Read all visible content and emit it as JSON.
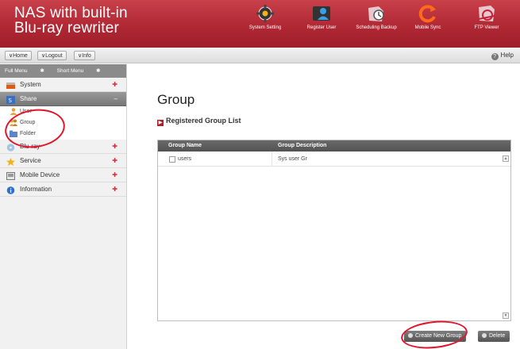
{
  "header": {
    "title_line1": "NAS with built-in",
    "title_line2": "Blu-ray rewriter",
    "nav": [
      {
        "label": "System Setting",
        "icon": "gear-icon"
      },
      {
        "label": "Register User",
        "icon": "register-user-icon"
      },
      {
        "label": "Scheduling Backup",
        "icon": "scheduling-backup-icon"
      },
      {
        "label": "Mobile Sync",
        "icon": "mobile-sync-icon"
      },
      {
        "label": "FTP Viewer",
        "icon": "ftp-viewer-icon"
      }
    ]
  },
  "toolbar": {
    "home": "Home",
    "logout": "Logout",
    "info": "Info",
    "help": "Help"
  },
  "sidebar": {
    "full_menu": "Full Menu",
    "short_menu": "Short Menu",
    "items": [
      {
        "label": "System"
      },
      {
        "label": "Share"
      },
      {
        "label": "Blu-ray"
      },
      {
        "label": "Service"
      },
      {
        "label": "Mobile Device"
      },
      {
        "label": "Information"
      }
    ],
    "share_sub": [
      {
        "label": "User"
      },
      {
        "label": "Group"
      },
      {
        "label": "Folder"
      }
    ]
  },
  "main": {
    "title": "Group",
    "section": "Registered Group List",
    "columns": [
      "Group Name",
      "Group Description"
    ],
    "rows": [
      {
        "name": "users",
        "description": "Sys user Gr"
      }
    ],
    "create_button": "Create New Group",
    "delete_button": "Delete"
  },
  "colors": {
    "brand": "#b22a35",
    "highlight": "#e3152a"
  }
}
